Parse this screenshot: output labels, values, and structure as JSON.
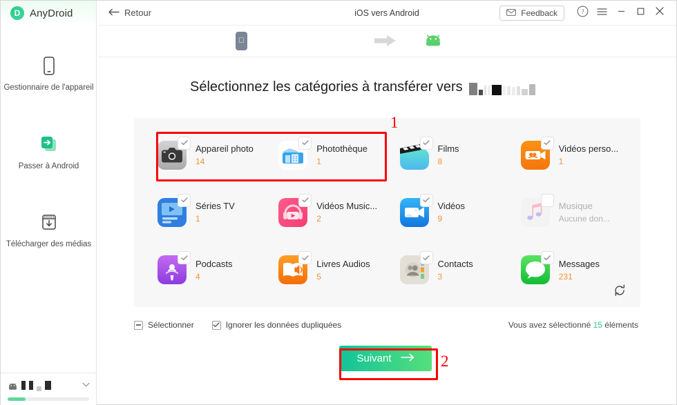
{
  "brand": {
    "name": "AnyDroid",
    "logo_letter": "D",
    "accent": "#2ecb84"
  },
  "sidebar": {
    "items": [
      {
        "id": "device-manager",
        "label": "Gestionnaire de l'appareil",
        "icon": "phone-icon"
      },
      {
        "id": "switch-android",
        "label": "Passer à Android",
        "icon": "transfer-arrow-icon"
      },
      {
        "id": "download-media",
        "label": "Télécharger des médias",
        "icon": "download-box-icon"
      }
    ],
    "bottom": {
      "device_icon": "android-icon",
      "device_name_redacted": true,
      "chevron": "chevron-down-icon",
      "storage_progress_percent": 22
    }
  },
  "titlebar": {
    "back_label": "Retour",
    "back_icon": "arrow-left-icon",
    "title": "iOS vers Android",
    "feedback_label": "Feedback",
    "feedback_icon": "envelope-icon",
    "help_icon": "question-circle-icon",
    "menu_icon": "hamburger-icon",
    "minimize_icon": "minimize-icon",
    "maximize_icon": "maximize-icon",
    "close_icon": "close-icon"
  },
  "device_strip": {
    "source_icon": "iphone-icon",
    "direction_icon": "arrow-right-icon",
    "target_icon": "android-robot-icon"
  },
  "main": {
    "heading": "Sélectionnez les catégories à transférer vers",
    "heading_device_redacted": true,
    "categories": [
      {
        "name": "Appareil photo",
        "count": "14",
        "checked": true,
        "disabled": false,
        "icon": "camera-icon"
      },
      {
        "name": "Photothèque",
        "count": "1",
        "checked": true,
        "disabled": false,
        "icon": "photo-library-icon"
      },
      {
        "name": "Films",
        "count": "8",
        "checked": true,
        "disabled": false,
        "icon": "movie-clapper-icon"
      },
      {
        "name": "Vidéos perso...",
        "count": "1",
        "checked": true,
        "disabled": false,
        "icon": "home-video-icon"
      },
      {
        "name": "Séries TV",
        "count": "1",
        "checked": true,
        "disabled": false,
        "icon": "tv-show-icon"
      },
      {
        "name": "Vidéos Music...",
        "count": "2",
        "checked": true,
        "disabled": false,
        "icon": "music-video-icon"
      },
      {
        "name": "Vidéos",
        "count": "9",
        "checked": true,
        "disabled": false,
        "icon": "video-icon"
      },
      {
        "name": "Musique",
        "count": "Aucune don...",
        "checked": false,
        "disabled": true,
        "icon": "music-note-icon"
      },
      {
        "name": "Podcasts",
        "count": "4",
        "checked": true,
        "disabled": false,
        "icon": "podcast-icon"
      },
      {
        "name": "Livres Audios",
        "count": "5",
        "checked": true,
        "disabled": false,
        "icon": "audiobook-icon"
      },
      {
        "name": "Contacts",
        "count": "3",
        "checked": true,
        "disabled": false,
        "icon": "contacts-icon"
      },
      {
        "name": "Messages",
        "count": "231",
        "checked": true,
        "disabled": false,
        "icon": "messages-icon"
      }
    ],
    "refresh_icon": "refresh-icon",
    "select_all_label": "Sélectionner",
    "select_all_state": "indeterminate",
    "ignore_duplicates_label": "Ignorer les données dupliquées",
    "ignore_duplicates_checked": true,
    "selection_summary_prefix": "Vous avez sélectionné",
    "selection_count": "15",
    "selection_summary_suffix": "éléments",
    "next_label": "Suivant",
    "next_icon": "arrow-right-icon"
  },
  "annotations": [
    {
      "id": "1",
      "label": "1"
    },
    {
      "id": "2",
      "label": "2"
    }
  ]
}
